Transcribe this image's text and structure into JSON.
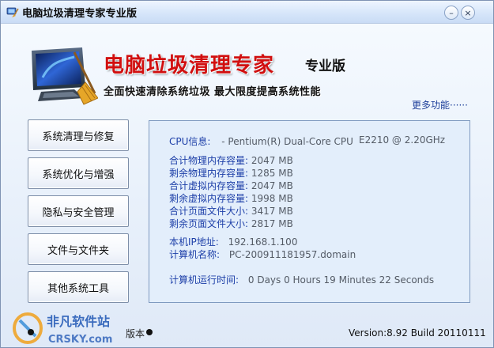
{
  "window": {
    "title": "电脑垃圾清理专家专业版",
    "minimize_symbol": "–",
    "close_symbol": "×"
  },
  "banner": {
    "title": "电脑垃圾清理专家",
    "edition": "专业版",
    "subtitle": "全面快速清除系统垃圾   最大限度提高系统性能",
    "more_link": "更多功能",
    "more_dots": "······"
  },
  "sidebar": {
    "items": [
      {
        "label": "系统清理与修复"
      },
      {
        "label": "系统优化与增强"
      },
      {
        "label": "隐私与安全管理"
      },
      {
        "label": "文件与文件夹"
      },
      {
        "label": "其他系统工具"
      }
    ]
  },
  "info": {
    "cpu_label": "CPU信息:",
    "cpu_value": "- Pentium(R) Dual-Core  CPU",
    "cpu_model": "E2210  @ 2.20GHz",
    "memory": [
      {
        "label": "合计物理内存容量:",
        "value": "2047 MB"
      },
      {
        "label": "剩余物理内存容量:",
        "value": "1285 MB"
      },
      {
        "label": "合计虚拟内存容量:",
        "value": "2047 MB"
      },
      {
        "label": "剩余虚拟内存容量:",
        "value": "1998 MB"
      },
      {
        "label": "合计页面文件大小:",
        "value": "3417 MB"
      },
      {
        "label": "剩余页面文件大小:",
        "value": "2817 MB"
      }
    ],
    "ip_label": "本机IP地址:",
    "ip_value": "192.168.1.100",
    "hostname_label": "计算机名称:",
    "hostname_value": "PC-200911181957.domain",
    "uptime_label": "计算机运行时间:",
    "uptime_value": "0 Days 0 Hours 19 Minutes 22 Seconds"
  },
  "footer": {
    "extra_text": "版本",
    "version": "Version:8.92 Build 20110111",
    "watermark_top": "非凡软件站",
    "watermark_bottom": "CRSKY.com"
  },
  "colors": {
    "accent_title": "#d10f0f",
    "label_blue": "#1d3fa8",
    "value_gray": "#545b66",
    "panel_bg": "#e3eefb"
  }
}
